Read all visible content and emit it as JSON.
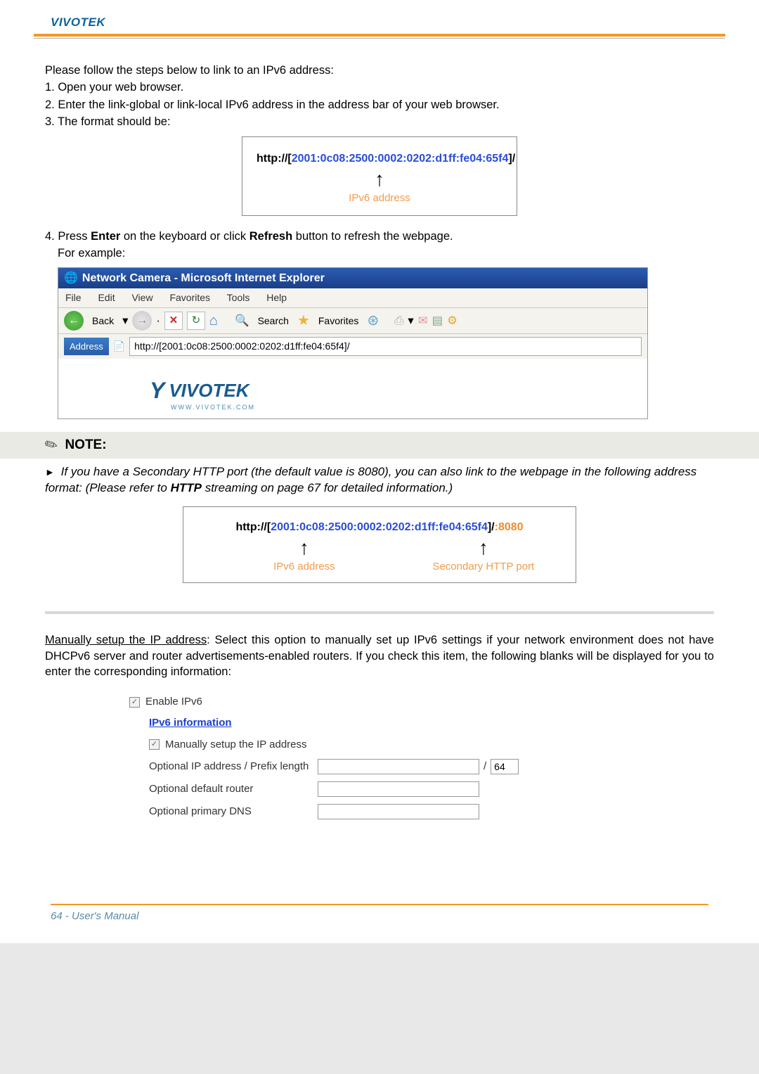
{
  "header": {
    "brand": "VIVOTEK"
  },
  "intro": {
    "line0": "Please follow the steps below to link to an IPv6 address:",
    "step1": "1. Open your web browser.",
    "step2": "2. Enter the link-global or link-local IPv6 address in the address bar of your web browser.",
    "step3": "3. The format should be:"
  },
  "urlbox1": {
    "prefix": "http://",
    "addr_open": "[",
    "addr": "2001:0c08:2500:0002:0202:d1ff:fe04:65f4",
    "addr_close": "]",
    "suffix": "/",
    "label": "IPv6 address"
  },
  "step4": {
    "line1": "4. Press Enter on the keyboard or click Refresh button to refresh the webpage.",
    "bold1": "Enter",
    "bold2": "Refresh",
    "line2": "For example:"
  },
  "browser": {
    "title": "Network Camera - Microsoft Internet Explorer",
    "menu": {
      "file": "File",
      "edit": "Edit",
      "view": "View",
      "favorites": "Favorites",
      "tools": "Tools",
      "help": "Help"
    },
    "toolbar": {
      "back": "Back",
      "search": "Search",
      "favorites": "Favorites"
    },
    "addr_label": "Address",
    "addr_value": "http://[2001:0c08:2500:0002:0202:d1ff:fe04:65f4]/",
    "logo": "VIVOTEK",
    "logo_sub": "WWW.VIVOTEK.COM"
  },
  "note": {
    "heading": "NOTE:",
    "body_pre": "If you have a Secondary HTTP port (the default value is 8080), you can also link to the webpage in the following address format: (Please refer to ",
    "body_bold": "HTTP",
    "body_post": " streaming on page 67 for detailed information.)"
  },
  "urlbox2": {
    "prefix": "http://",
    "addr_open": "[",
    "addr": "2001:0c08:2500:0002:0202:d1ff:fe04:65f4",
    "addr_close": "]",
    "mid": "/",
    "port_colon": ":",
    "port": "8080",
    "label1": "IPv6 address",
    "label2": "Secondary HTTP port"
  },
  "manual": {
    "heading": "Manually setup the IP address",
    "body": ": Select this option to manually set up IPv6 settings if your network environment does not have DHCPv6 server and router advertisements-enabled routers. If you check this item, the following blanks will be displayed for you to enter the corresponding information:"
  },
  "settings": {
    "enable": "Enable IPv6",
    "info_link": "IPv6 information",
    "manual_cb": "Manually setup the IP address",
    "opt_ip": "Optional IP address / Prefix length",
    "prefix_sep": "/",
    "prefix_val": "64",
    "opt_router": "Optional default router",
    "opt_dns": "Optional primary DNS"
  },
  "footer": {
    "text": "64 - User's Manual"
  }
}
